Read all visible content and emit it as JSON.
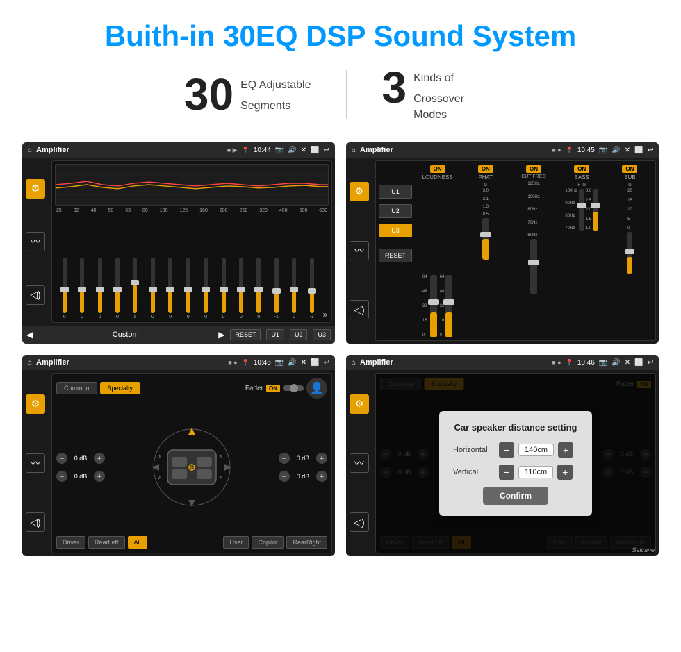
{
  "header": {
    "title": "Buith-in 30EQ DSP Sound System",
    "stat1_number": "30",
    "stat1_desc_line1": "EQ Adjustable",
    "stat1_desc_line2": "Segments",
    "stat2_number": "3",
    "stat2_desc_line1": "Kinds of",
    "stat2_desc_line2": "Crossover Modes"
  },
  "screens": [
    {
      "id": "eq-screen",
      "status_bar": {
        "home": "⌂",
        "title": "Amplifier",
        "icons": "■ ▶",
        "pin": "📍",
        "time": "10:44",
        "camera": "📷",
        "volume": "🔊",
        "x": "✕",
        "back": "⟵"
      },
      "eq_labels": [
        "25",
        "32",
        "40",
        "50",
        "63",
        "80",
        "100",
        "125",
        "160",
        "200",
        "250",
        "320",
        "400",
        "500",
        "630"
      ],
      "eq_values": [
        "0",
        "0",
        "0",
        "0",
        "5",
        "0",
        "0",
        "0",
        "0",
        "0",
        "0",
        "0",
        "-1",
        "0",
        "-1"
      ],
      "preset": "Custom",
      "buttons": [
        "RESET",
        "U1",
        "U2",
        "U3"
      ]
    },
    {
      "id": "crossover-screen",
      "status_bar": {
        "title": "Amplifier",
        "time": "10:45"
      },
      "u_buttons": [
        "U1",
        "U2",
        "U3"
      ],
      "active_u": "U3",
      "reset": "RESET",
      "channels": [
        {
          "on": true,
          "label": "LOUDNESS"
        },
        {
          "on": true,
          "label": "PHAT"
        },
        {
          "on": true,
          "label": "CUT FREQ"
        },
        {
          "on": true,
          "label": "BASS"
        },
        {
          "on": true,
          "label": "SUB"
        }
      ]
    },
    {
      "id": "specialty-screen",
      "status_bar": {
        "title": "Amplifier",
        "time": "10:46"
      },
      "tabs": [
        "Common",
        "Specialty"
      ],
      "active_tab": "Specialty",
      "fader_label": "Fader",
      "fader_on": "ON",
      "db_values": [
        "0 dB",
        "0 dB",
        "0 dB",
        "0 dB"
      ],
      "zone_buttons": [
        "Driver",
        "RearLeft",
        "All",
        "User",
        "Copilot",
        "RearRight"
      ]
    },
    {
      "id": "distance-screen",
      "status_bar": {
        "title": "Amplifier",
        "time": "10:46"
      },
      "tabs": [
        "Common",
        "Specialty"
      ],
      "active_tab": "Specialty",
      "dialog": {
        "title": "Car speaker distance setting",
        "horizontal_label": "Horizontal",
        "horizontal_value": "140cm",
        "vertical_label": "Vertical",
        "vertical_value": "110cm",
        "confirm_label": "Confirm"
      },
      "db_values": [
        "0 dB",
        "0 dB"
      ],
      "zone_buttons": [
        "Driver",
        "RearLeft",
        "All",
        "User",
        "Copilot",
        "RearRight"
      ],
      "watermark": "Seicane"
    }
  ],
  "icons": {
    "home": "⌂",
    "back": "↺",
    "music": "♪",
    "speaker": "◁))",
    "equalizer": "≡",
    "person": "👤"
  }
}
